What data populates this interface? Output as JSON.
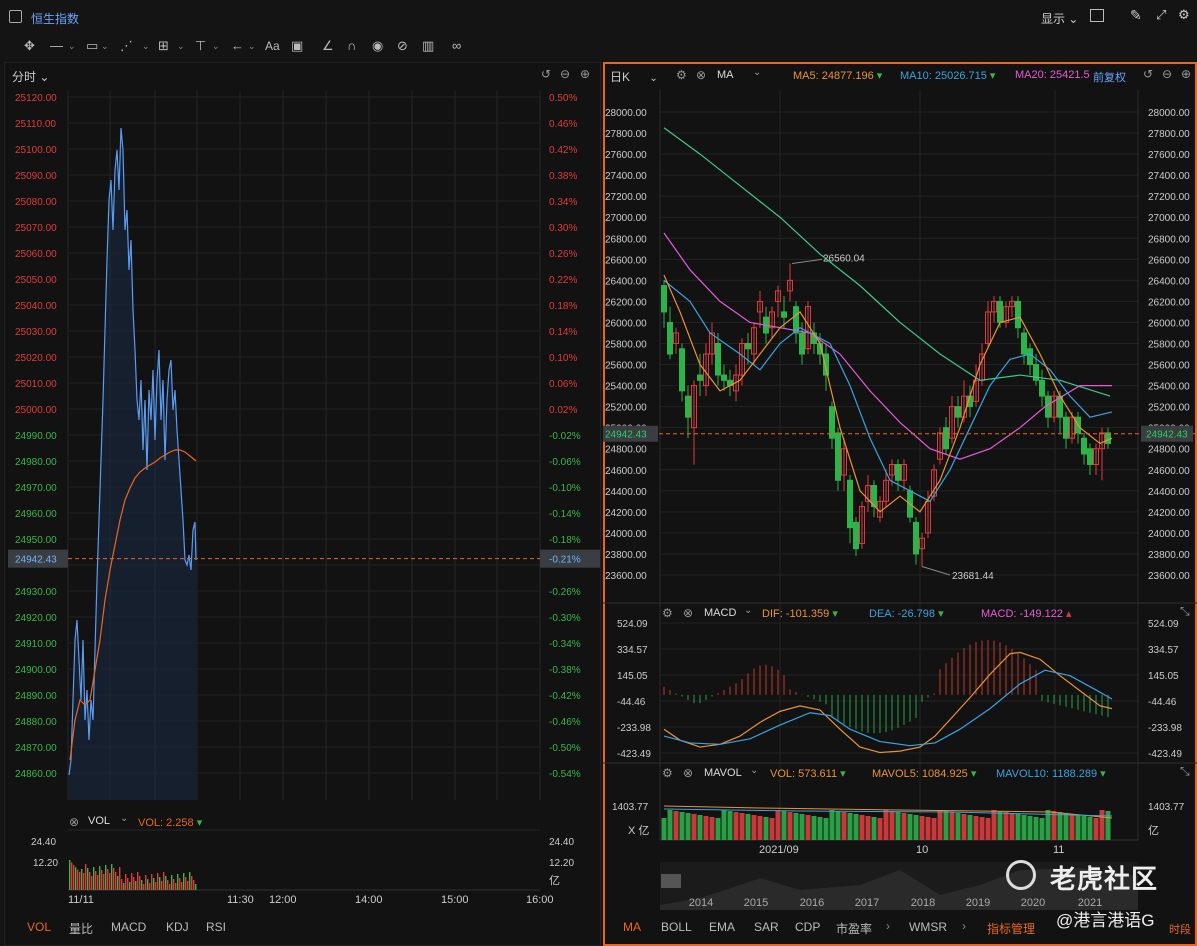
{
  "title": {
    "checkbox_icon": "checkbox-icon",
    "label": "恒生指数",
    "display_label": "显示",
    "window_icons": [
      "layout-icon",
      "pen-icon",
      "fullscreen-icon",
      "settings-icon"
    ]
  },
  "toolbar": {
    "tools": [
      "move-icon",
      "line-tool-icon",
      "rect-tool-icon",
      "trend-tool-icon",
      "fib-tool-icon",
      "measure-tool-icon",
      "arrow-tool-icon",
      "text-tool-icon",
      "comment-tool-icon",
      "angle-tool-icon",
      "magnet-icon",
      "eye-icon",
      "hide-icon",
      "trash-icon",
      "link-icon"
    ],
    "text_tool": "Aa"
  },
  "left": {
    "period": "分时",
    "yticks": [
      "25120.00",
      "25110.00",
      "25100.00",
      "25090.00",
      "25080.00",
      "25070.00",
      "25060.00",
      "25050.00",
      "25040.00",
      "25030.00",
      "25020.00",
      "25010.00",
      "25000.00",
      "24990.00",
      "24980.00",
      "24970.00",
      "24960.00",
      "24950.00",
      "24942.43",
      "24930.00",
      "24920.00",
      "24910.00",
      "24900.00",
      "24890.00",
      "24880.00",
      "24870.00",
      "24860.00"
    ],
    "pticks": [
      "0.50%",
      "0.46%",
      "0.42%",
      "0.38%",
      "0.34%",
      "0.30%",
      "0.26%",
      "0.22%",
      "0.18%",
      "0.14%",
      "0.10%",
      "0.06%",
      "0.02%",
      "-0.02%",
      "-0.06%",
      "-0.10%",
      "-0.14%",
      "-0.18%",
      "-0.21%",
      "-0.26%",
      "-0.30%",
      "-0.34%",
      "-0.38%",
      "-0.42%",
      "-0.46%",
      "-0.50%",
      "-0.54%"
    ],
    "current_price": "24942.43",
    "current_pct": "-0.21%",
    "vol_label": "VOL",
    "vol_value": "VOL: 2.258",
    "vol_ticks": [
      "24.40",
      "12.20"
    ],
    "vol_unit": "亿",
    "xticks": [
      "11/11",
      "11:30",
      "12:00",
      "14:00",
      "15:00",
      "16:00"
    ],
    "tabs": [
      "VOL",
      "量比",
      "MACD",
      "KDJ",
      "RSI"
    ],
    "colors": {
      "up": "#e03b3b",
      "down": "#3bb54a",
      "line": "#5b9bf0",
      "avg": "#e8671f"
    }
  },
  "right": {
    "period": "日K",
    "ma_label": "MA",
    "ma5": "MA5: 24877.196",
    "ma10": "MA10: 25026.715",
    "ma20": "MA20: 25421.5",
    "adjust": "前复权",
    "yticks": [
      "28000.00",
      "27800.00",
      "27600.00",
      "27400.00",
      "27200.00",
      "27000.00",
      "26800.00",
      "26600.00",
      "26400.00",
      "26200.00",
      "26000.00",
      "25800.00",
      "25600.00",
      "25400.00",
      "25200.00",
      "25000.00",
      "24800.00",
      "24600.00",
      "24400.00",
      "24200.00",
      "24000.00",
      "23800.00",
      "23600.00"
    ],
    "current_price": "24942.43",
    "high_label": "26560.04",
    "low_label": "23681.44",
    "macd_label": "MACD",
    "dif": "DIF: -101.359",
    "dea": "DEA: -26.798",
    "macd": "MACD: -149.122",
    "macd_ticks": [
      "524.09",
      "334.57",
      "145.05",
      "-44.46",
      "-233.98",
      "-423.49"
    ],
    "mavol_label": "MAVOL",
    "vol": "VOL: 573.611",
    "mavol5": "MAVOL5: 1084.925",
    "mavol10": "MAVOL10: 1188.289",
    "vol_tick": "1403.77",
    "vol_unit": "X 亿",
    "xticks": [
      "2021/09",
      "10",
      "11"
    ],
    "years": [
      "2014",
      "2015",
      "2016",
      "2017",
      "2018",
      "2019",
      "2020",
      "2021"
    ],
    "tabs": [
      "MA",
      "BOLL",
      "EMA",
      "SAR",
      "CDP",
      "市盈率",
      "WMSR",
      "指标管理"
    ],
    "period_tab": "时段",
    "colors": {
      "ma5": "#e89436",
      "ma10": "#3aa3e0",
      "ma20": "#e65bd4",
      "ma60": "#3ec98a"
    }
  },
  "watermark": {
    "brand": "老虎社区",
    "handle": "@港言港语G"
  }
}
